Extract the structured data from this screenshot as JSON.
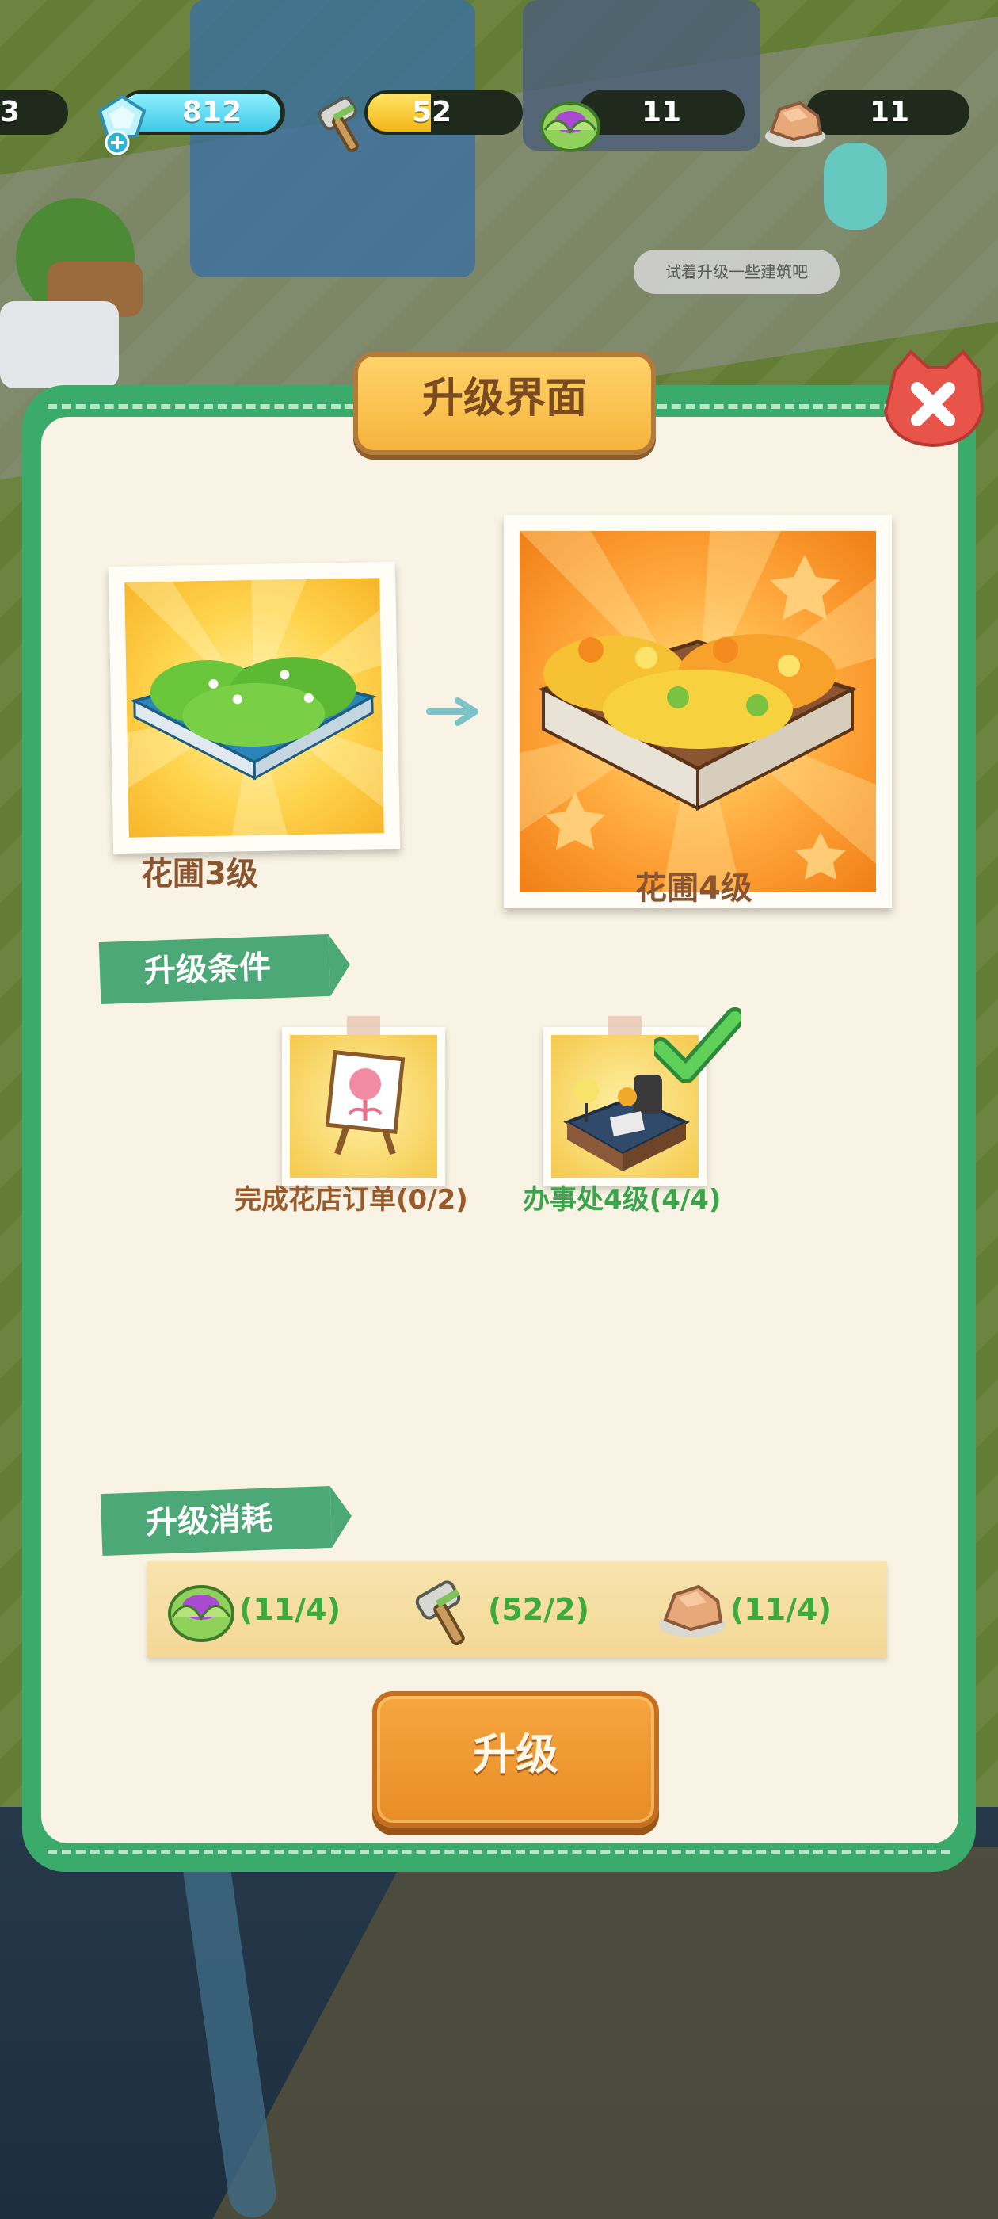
{
  "resources": {
    "partial_left": "3",
    "gems": "812",
    "hammers": "52",
    "cabbages": "11",
    "stones": "11"
  },
  "bubble_text": "试着升级一些建筑吧",
  "modal": {
    "title": "升级界面",
    "current_building_label": "花圃3级",
    "next_building_label": "花圃4级",
    "conditions_title": "升级条件",
    "conditions": [
      {
        "text": "完成花店订单(0/2)",
        "met": false
      },
      {
        "text": "办事处4级(4/4)",
        "met": true
      }
    ],
    "cost_title": "升级消耗",
    "costs": [
      {
        "icon": "cabbage-icon",
        "text": "(11/4)"
      },
      {
        "icon": "hammer-icon",
        "text": "(52/2)"
      },
      {
        "icon": "stone-icon",
        "text": "(11/4)"
      }
    ],
    "upgrade_button": "升级"
  },
  "colors": {
    "modal_border": "#3aab6a",
    "panel": "#f8f3e4",
    "title_plate": "#f6b43c",
    "ribbon": "#4da877",
    "cost_text": "#3daa3d",
    "upgrade_button": "#e88d26",
    "close_button": "#e8534a"
  }
}
